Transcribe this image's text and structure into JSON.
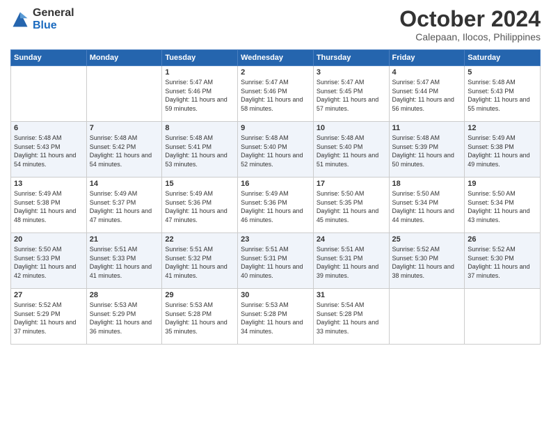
{
  "logo": {
    "general": "General",
    "blue": "Blue"
  },
  "title": "October 2024",
  "subtitle": "Calepaan, Ilocos, Philippines",
  "days_header": [
    "Sunday",
    "Monday",
    "Tuesday",
    "Wednesday",
    "Thursday",
    "Friday",
    "Saturday"
  ],
  "weeks": [
    [
      {
        "day": "",
        "info": ""
      },
      {
        "day": "",
        "info": ""
      },
      {
        "day": "1",
        "info": "Sunrise: 5:47 AM\nSunset: 5:46 PM\nDaylight: 11 hours\nand 59 minutes."
      },
      {
        "day": "2",
        "info": "Sunrise: 5:47 AM\nSunset: 5:46 PM\nDaylight: 11 hours\nand 58 minutes."
      },
      {
        "day": "3",
        "info": "Sunrise: 5:47 AM\nSunset: 5:45 PM\nDaylight: 11 hours\nand 57 minutes."
      },
      {
        "day": "4",
        "info": "Sunrise: 5:47 AM\nSunset: 5:44 PM\nDaylight: 11 hours\nand 56 minutes."
      },
      {
        "day": "5",
        "info": "Sunrise: 5:48 AM\nSunset: 5:43 PM\nDaylight: 11 hours\nand 55 minutes."
      }
    ],
    [
      {
        "day": "6",
        "info": "Sunrise: 5:48 AM\nSunset: 5:43 PM\nDaylight: 11 hours\nand 54 minutes."
      },
      {
        "day": "7",
        "info": "Sunrise: 5:48 AM\nSunset: 5:42 PM\nDaylight: 11 hours\nand 54 minutes."
      },
      {
        "day": "8",
        "info": "Sunrise: 5:48 AM\nSunset: 5:41 PM\nDaylight: 11 hours\nand 53 minutes."
      },
      {
        "day": "9",
        "info": "Sunrise: 5:48 AM\nSunset: 5:40 PM\nDaylight: 11 hours\nand 52 minutes."
      },
      {
        "day": "10",
        "info": "Sunrise: 5:48 AM\nSunset: 5:40 PM\nDaylight: 11 hours\nand 51 minutes."
      },
      {
        "day": "11",
        "info": "Sunrise: 5:48 AM\nSunset: 5:39 PM\nDaylight: 11 hours\nand 50 minutes."
      },
      {
        "day": "12",
        "info": "Sunrise: 5:49 AM\nSunset: 5:38 PM\nDaylight: 11 hours\nand 49 minutes."
      }
    ],
    [
      {
        "day": "13",
        "info": "Sunrise: 5:49 AM\nSunset: 5:38 PM\nDaylight: 11 hours\nand 48 minutes."
      },
      {
        "day": "14",
        "info": "Sunrise: 5:49 AM\nSunset: 5:37 PM\nDaylight: 11 hours\nand 47 minutes."
      },
      {
        "day": "15",
        "info": "Sunrise: 5:49 AM\nSunset: 5:36 PM\nDaylight: 11 hours\nand 47 minutes."
      },
      {
        "day": "16",
        "info": "Sunrise: 5:49 AM\nSunset: 5:36 PM\nDaylight: 11 hours\nand 46 minutes."
      },
      {
        "day": "17",
        "info": "Sunrise: 5:50 AM\nSunset: 5:35 PM\nDaylight: 11 hours\nand 45 minutes."
      },
      {
        "day": "18",
        "info": "Sunrise: 5:50 AM\nSunset: 5:34 PM\nDaylight: 11 hours\nand 44 minutes."
      },
      {
        "day": "19",
        "info": "Sunrise: 5:50 AM\nSunset: 5:34 PM\nDaylight: 11 hours\nand 43 minutes."
      }
    ],
    [
      {
        "day": "20",
        "info": "Sunrise: 5:50 AM\nSunset: 5:33 PM\nDaylight: 11 hours\nand 42 minutes."
      },
      {
        "day": "21",
        "info": "Sunrise: 5:51 AM\nSunset: 5:33 PM\nDaylight: 11 hours\nand 41 minutes."
      },
      {
        "day": "22",
        "info": "Sunrise: 5:51 AM\nSunset: 5:32 PM\nDaylight: 11 hours\nand 41 minutes."
      },
      {
        "day": "23",
        "info": "Sunrise: 5:51 AM\nSunset: 5:31 PM\nDaylight: 11 hours\nand 40 minutes."
      },
      {
        "day": "24",
        "info": "Sunrise: 5:51 AM\nSunset: 5:31 PM\nDaylight: 11 hours\nand 39 minutes."
      },
      {
        "day": "25",
        "info": "Sunrise: 5:52 AM\nSunset: 5:30 PM\nDaylight: 11 hours\nand 38 minutes."
      },
      {
        "day": "26",
        "info": "Sunrise: 5:52 AM\nSunset: 5:30 PM\nDaylight: 11 hours\nand 37 minutes."
      }
    ],
    [
      {
        "day": "27",
        "info": "Sunrise: 5:52 AM\nSunset: 5:29 PM\nDaylight: 11 hours\nand 37 minutes."
      },
      {
        "day": "28",
        "info": "Sunrise: 5:53 AM\nSunset: 5:29 PM\nDaylight: 11 hours\nand 36 minutes."
      },
      {
        "day": "29",
        "info": "Sunrise: 5:53 AM\nSunset: 5:28 PM\nDaylight: 11 hours\nand 35 minutes."
      },
      {
        "day": "30",
        "info": "Sunrise: 5:53 AM\nSunset: 5:28 PM\nDaylight: 11 hours\nand 34 minutes."
      },
      {
        "day": "31",
        "info": "Sunrise: 5:54 AM\nSunset: 5:28 PM\nDaylight: 11 hours\nand 33 minutes."
      },
      {
        "day": "",
        "info": ""
      },
      {
        "day": "",
        "info": ""
      }
    ]
  ]
}
